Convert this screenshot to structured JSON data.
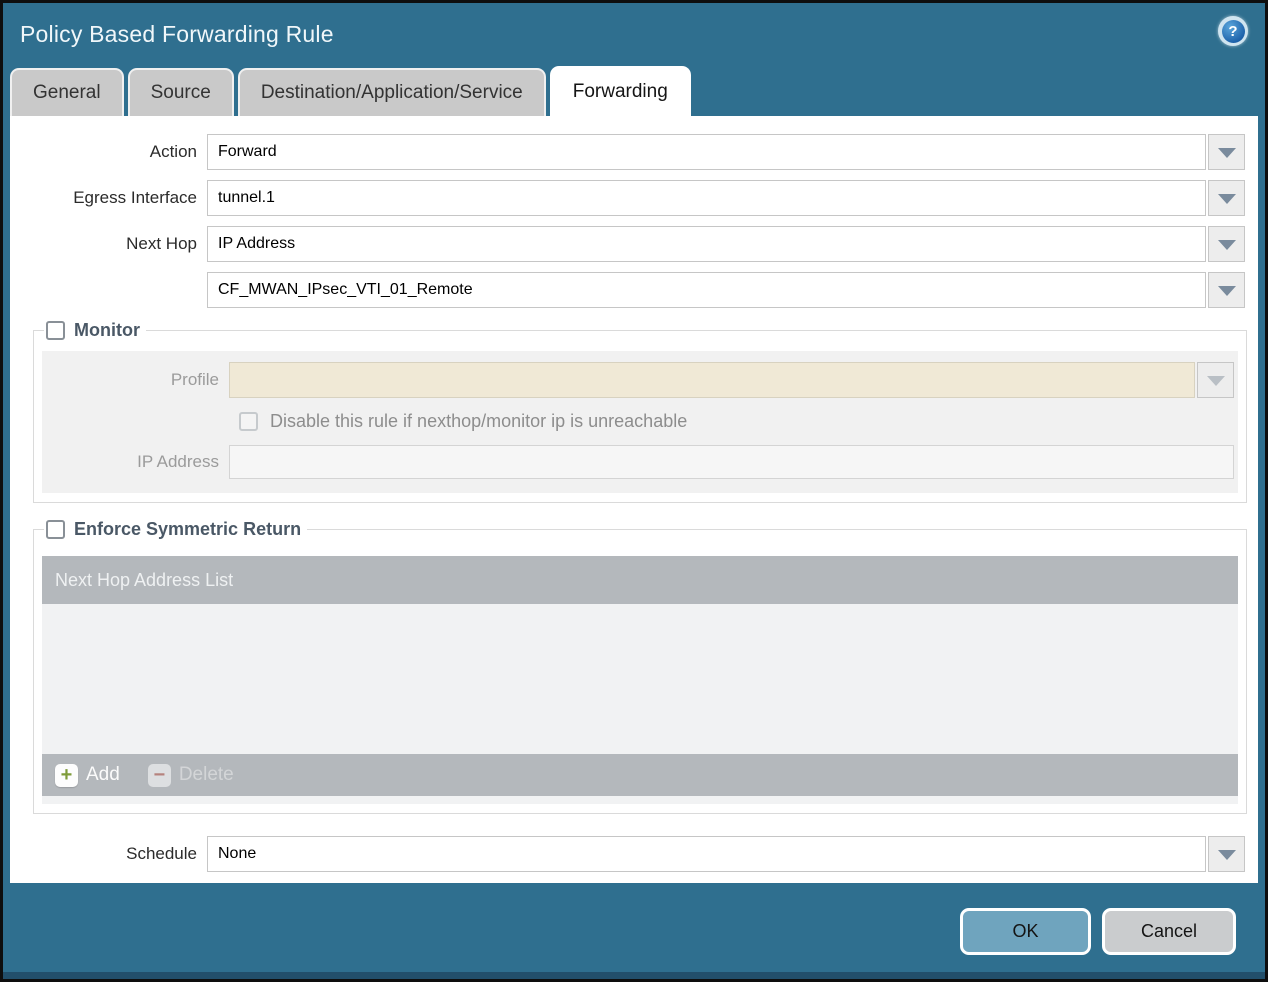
{
  "colors": {
    "teal": "#2F6F8F",
    "tab-gray": "#C9C9C9",
    "legend-blue": "#4A5866",
    "cream": "#F0E9D6",
    "table-gray": "#B4B8BC",
    "table-body": "#F1F2F3",
    "add-green": "#7F9C3A",
    "delete-red": "#B5827D",
    "ok-blue": "#6FA4BE",
    "cancel-gray": "#CACCCE"
  },
  "dialog": {
    "title": "Policy Based Forwarding Rule",
    "help_icon": "question-mark"
  },
  "tabs": [
    {
      "label": "General",
      "active": false
    },
    {
      "label": "Source",
      "active": false
    },
    {
      "label": "Destination/Application/Service",
      "active": false
    },
    {
      "label": "Forwarding",
      "active": true
    }
  ],
  "form": {
    "action": {
      "label": "Action",
      "value": "Forward"
    },
    "egress_interface": {
      "label": "Egress Interface",
      "value": "tunnel.1"
    },
    "next_hop": {
      "label": "Next Hop",
      "value": "IP Address"
    },
    "next_hop_address": {
      "value": "CF_MWAN_IPsec_VTI_01_Remote"
    },
    "schedule": {
      "label": "Schedule",
      "value": "None"
    }
  },
  "monitor": {
    "legend": "Monitor",
    "checked": false,
    "profile": {
      "label": "Profile",
      "value": ""
    },
    "disable_rule": {
      "label": "Disable this rule if nexthop/monitor ip is unreachable",
      "checked": false
    },
    "ip_address": {
      "label": "IP Address",
      "value": ""
    }
  },
  "symmetric_return": {
    "legend": "Enforce Symmetric Return",
    "checked": false,
    "grid": {
      "header": "Next Hop Address List",
      "rows": []
    },
    "add_label": "Add",
    "delete_label": "Delete"
  },
  "footer": {
    "ok_label": "OK",
    "cancel_label": "Cancel"
  }
}
